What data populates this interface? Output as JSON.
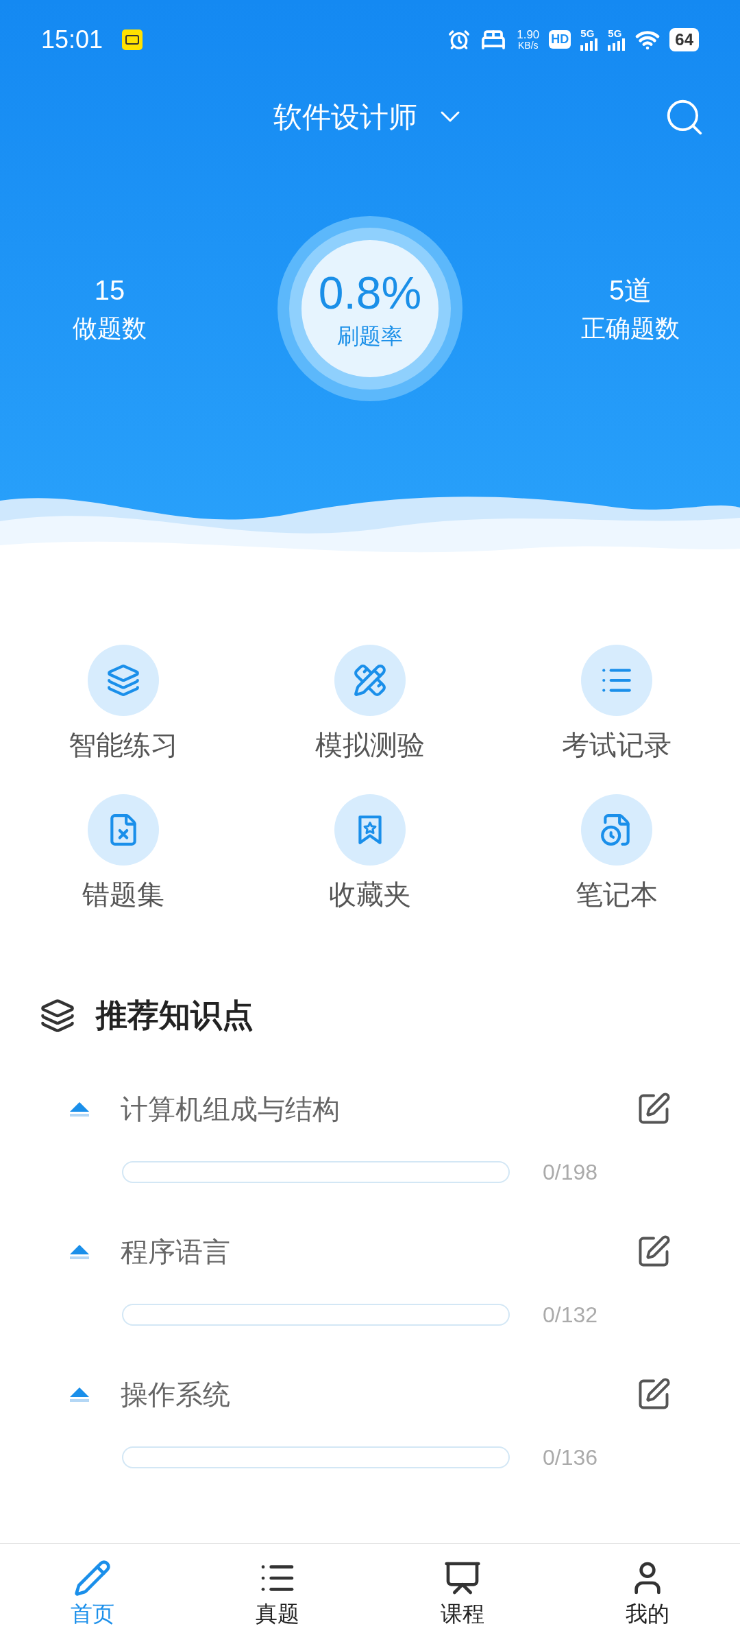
{
  "status_bar": {
    "time": "15:01",
    "speed": "1.90",
    "speed_unit": "KB/s",
    "hd": "HD",
    "sims": [
      {
        "network": "5G"
      },
      {
        "network": "5G"
      }
    ],
    "battery": "64"
  },
  "header": {
    "title": "软件设计师",
    "stats": [
      {
        "value": "15",
        "label": "做题数"
      },
      {
        "value": "5道",
        "label": "正确题数"
      }
    ],
    "rate": {
      "value": "0.8%",
      "label": "刷题率"
    }
  },
  "shortcuts": [
    {
      "label": "智能练习"
    },
    {
      "label": "模拟测验"
    },
    {
      "label": "考试记录"
    },
    {
      "label": "错题集"
    },
    {
      "label": "收藏夹"
    },
    {
      "label": "笔记本"
    }
  ],
  "section": {
    "title": "推荐知识点",
    "items": [
      {
        "title": "计算机组成与结构",
        "count": "0/198"
      },
      {
        "title": "程序语言",
        "count": "0/132"
      },
      {
        "title": "操作系统",
        "count": "0/136"
      }
    ]
  },
  "nav": [
    {
      "label": "首页",
      "selected": true
    },
    {
      "label": "真题",
      "selected": false
    },
    {
      "label": "课程",
      "selected": false
    },
    {
      "label": "我的",
      "selected": false
    }
  ]
}
